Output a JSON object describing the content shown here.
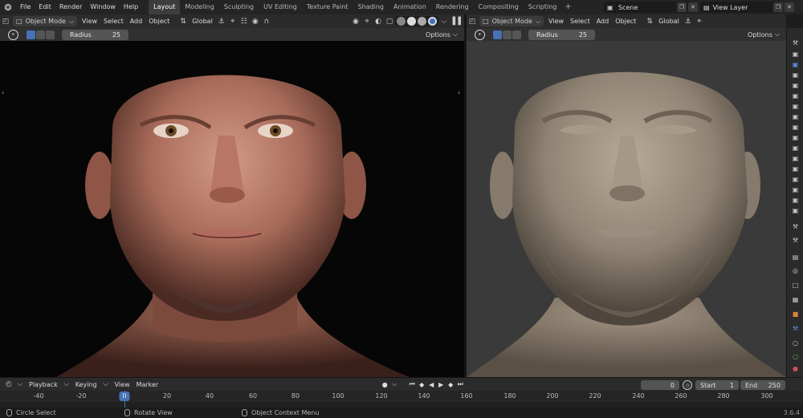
{
  "app": {
    "menu": [
      "File",
      "Edit",
      "Render",
      "Window",
      "Help"
    ],
    "workspaces": [
      "Layout",
      "Modeling",
      "Sculpting",
      "UV Editing",
      "Texture Paint",
      "Shading",
      "Animation",
      "Rendering",
      "Compositing",
      "Scripting"
    ],
    "active_workspace": "Layout",
    "add_workspace": "+",
    "scene_name": "Scene",
    "view_layer": "View Layer",
    "version": "3.6.4"
  },
  "viewport_left": {
    "mode": "Object Mode",
    "menus": [
      "View",
      "Select",
      "Add",
      "Object"
    ],
    "orientation": "Global",
    "radius_label": "Radius",
    "radius_value": "25",
    "options": "Options"
  },
  "viewport_right": {
    "mode": "Object Mode",
    "menus": [
      "View",
      "Select",
      "Add",
      "Object"
    ],
    "orientation": "Global",
    "radius_label": "Radius",
    "radius_value": "25",
    "options": "Options"
  },
  "timeline": {
    "menus": [
      "Playback",
      "Keying",
      "View",
      "Marker"
    ],
    "current_frame": "0",
    "start_label": "Start",
    "start_value": "1",
    "end_label": "End",
    "end_value": "250",
    "ruler_ticks": [
      "-40",
      "-20",
      "0",
      "20",
      "40",
      "60",
      "80",
      "100",
      "120",
      "140",
      "160",
      "180",
      "200",
      "220",
      "240",
      "260",
      "280",
      "300"
    ],
    "playhead": "0"
  },
  "statusbar": {
    "left": "Circle Select",
    "middle": "Rotate View",
    "right": "Object Context Menu"
  },
  "colors": {
    "accent": "#4772b3",
    "header_bg": "#2b2b2b",
    "viewport_right_bg": "#363636"
  }
}
